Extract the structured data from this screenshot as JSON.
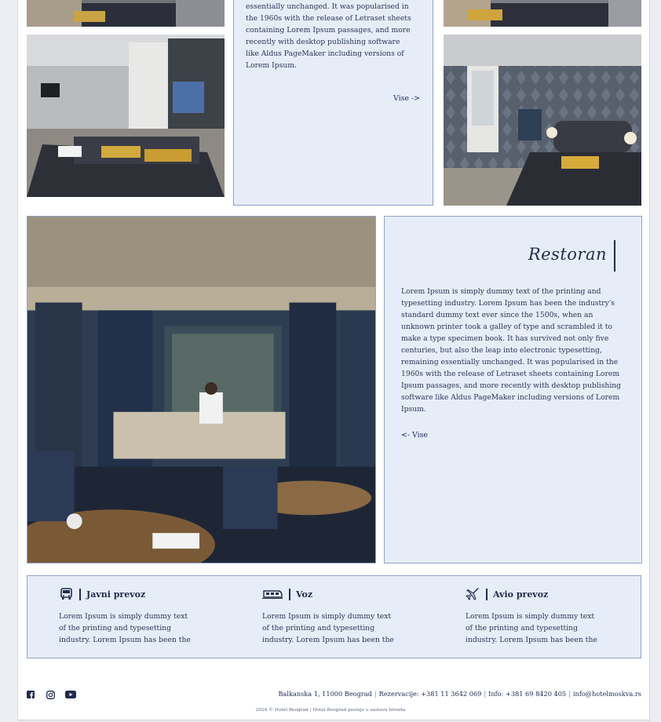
{
  "rooms": {
    "text_top": "essentially unchanged. It was popularised in the 1960s with the release of Letraset sheets containing Lorem Ipsum passages, and more recently with desktop publishing software like Aldus PageMaker including versions of Lorem Ipsum.",
    "more_label": "Vise ->"
  },
  "restaurant": {
    "title": "Restoran",
    "text": "Lorem Ipsum is simply dummy text of the printing and typesetting industry. Lorem Ipsum has been the industry's standard dummy text ever since the 1500s, when an unknown printer took a galley of type and scrambled it to make a type specimen book. It has survived not only five centuries, but also the leap into electronic typesetting, remaining essentially unchanged. It was popularised in the 1960s with the release of Letraset sheets containing Lorem Ipsum passages, and more recently with desktop publishing software like Aldus PageMaker including versions of Lorem Ipsum.",
    "more_label": "<- Vise"
  },
  "transport": [
    {
      "icon": "bus-icon",
      "title": "Javni prevoz",
      "text": "Lorem Ipsum is simply dummy text of the printing and typesetting industry. Lorem Ipsum has been the"
    },
    {
      "icon": "train-icon",
      "title": "Voz",
      "text": "Lorem Ipsum is simply dummy text of the printing and typesetting industry. Lorem Ipsum has been the"
    },
    {
      "icon": "plane-icon",
      "title": "Avio prevoz",
      "text": "Lorem Ipsum is simply dummy text of the printing and typesetting industry. Lorem Ipsum has been the"
    }
  ],
  "footer": {
    "social": [
      "facebook-icon",
      "instagram-icon",
      "youtube-icon"
    ],
    "address": "Balkanska 1, 11000 Beograd",
    "reservations": "Rezervacije: +381 11 3642 069",
    "info": "Info: +381 69 8420 405",
    "email": "info@hotelmoskva.rs",
    "copyright": "2020 © Hotel Beograd | Hotel Beograd posluje u sastavu brenda"
  },
  "colors": {
    "panel_bg": "#e7edf8",
    "panel_border": "#8fa4c9",
    "text_dark": "#1f2b4d"
  }
}
